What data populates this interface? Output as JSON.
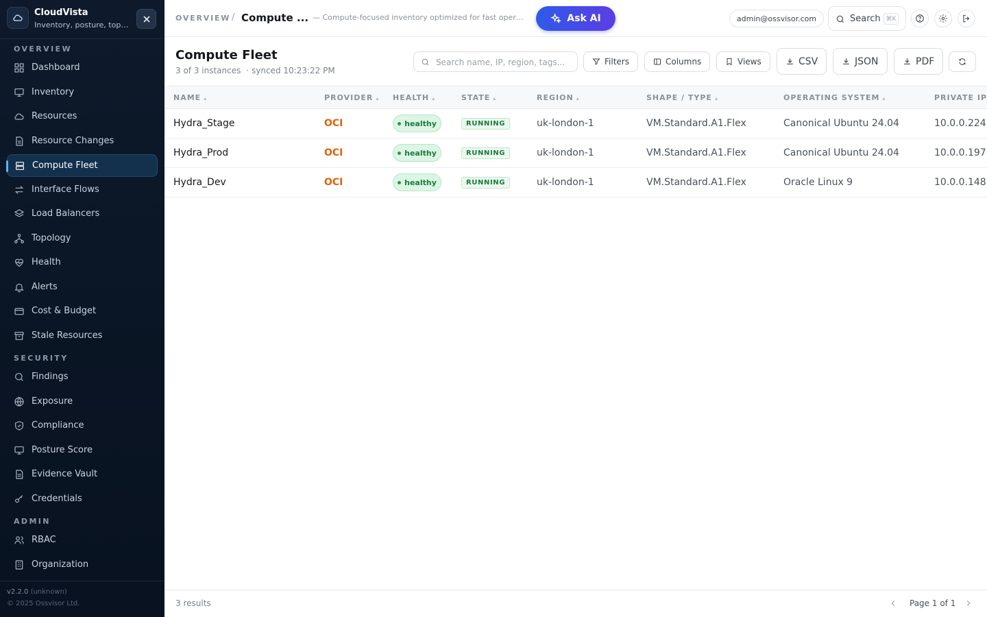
{
  "app": {
    "name": "CloudVista",
    "tagline": "Inventory, posture, topology"
  },
  "sidebar": {
    "sections": [
      {
        "heading": "OVERVIEW",
        "items": [
          {
            "label": "Dashboard",
            "icon": "dashboard-icon"
          },
          {
            "label": "Inventory",
            "icon": "monitor-icon"
          },
          {
            "label": "Resources",
            "icon": "cloud-icon"
          },
          {
            "label": "Resource Changes",
            "icon": "file-icon"
          },
          {
            "label": "Compute Fleet",
            "icon": "server-icon",
            "active": true
          },
          {
            "label": "Interface Flows",
            "icon": "arrows-icon"
          },
          {
            "label": "Load Balancers",
            "icon": "layers-icon"
          },
          {
            "label": "Topology",
            "icon": "topology-icon"
          },
          {
            "label": "Health",
            "icon": "heart-pulse-icon"
          },
          {
            "label": "Alerts",
            "icon": "bell-icon"
          },
          {
            "label": "Cost & Budget",
            "icon": "wallet-icon"
          },
          {
            "label": "Stale Resources",
            "icon": "archive-icon"
          }
        ]
      },
      {
        "heading": "SECURITY",
        "items": [
          {
            "label": "Findings",
            "icon": "search-icon"
          },
          {
            "label": "Exposure",
            "icon": "globe-icon"
          },
          {
            "label": "Compliance",
            "icon": "shield-icon"
          },
          {
            "label": "Posture Score",
            "icon": "monitor-icon"
          },
          {
            "label": "Evidence Vault",
            "icon": "file-icon"
          },
          {
            "label": "Credentials",
            "icon": "key-icon"
          }
        ]
      },
      {
        "heading": "ADMIN",
        "items": [
          {
            "label": "RBAC",
            "icon": "users-icon"
          },
          {
            "label": "Organization",
            "icon": "building-icon"
          }
        ]
      }
    ],
    "version": "v2.2.0",
    "build": "(unknown)",
    "copyright": "© 2025 Ossvisor Ltd."
  },
  "topbar": {
    "breadcrumb_root": "OVERVIEW",
    "breadcrumb_sep": "/",
    "breadcrumb_current": "Compute ...",
    "description": "— Compute-focused inventory optimized for fast operations",
    "ask_ai_label": "Ask AI",
    "user_email": "admin@ossvisor.com",
    "search_label": "Search",
    "search_shortcut": "⌘K"
  },
  "page": {
    "title": "Compute Fleet",
    "count_text": "3 of 3 instances",
    "synced_text": "· synced 10:23:22 PM",
    "search_placeholder": "Search name, IP, region, tags...",
    "toolbar": {
      "filters": "Filters",
      "columns": "Columns",
      "views": "Views",
      "csv": "CSV",
      "json": "JSON",
      "pdf": "PDF"
    }
  },
  "table": {
    "columns": [
      "NAME",
      "PROVIDER",
      "HEALTH",
      "STATE",
      "REGION",
      "SHAPE / TYPE",
      "OPERATING SYSTEM",
      "PRIVATE IP"
    ],
    "rows": [
      {
        "name": "Hydra_Stage",
        "provider": "OCI",
        "health": "healthy",
        "state": "RUNNING",
        "region": "uk-london-1",
        "shape": "VM.Standard.A1.Flex",
        "os": "Canonical Ubuntu 24.04",
        "private_ip": "10.0.0.224"
      },
      {
        "name": "Hydra_Prod",
        "provider": "OCI",
        "health": "healthy",
        "state": "RUNNING",
        "region": "uk-london-1",
        "shape": "VM.Standard.A1.Flex",
        "os": "Canonical Ubuntu 24.04",
        "private_ip": "10.0.0.197"
      },
      {
        "name": "Hydra_Dev",
        "provider": "OCI",
        "health": "healthy",
        "state": "RUNNING",
        "region": "uk-london-1",
        "shape": "VM.Standard.A1.Flex",
        "os": "Oracle Linux 9",
        "private_ip": "10.0.0.148"
      }
    ]
  },
  "footer": {
    "results": "3 results",
    "page_label": "Page 1 of 1"
  },
  "colors": {
    "accent": "#2f5ae8",
    "provider_oci": "#e0620f",
    "healthy": "#1c7a3d",
    "sidebar_bg": "#0b1626"
  }
}
